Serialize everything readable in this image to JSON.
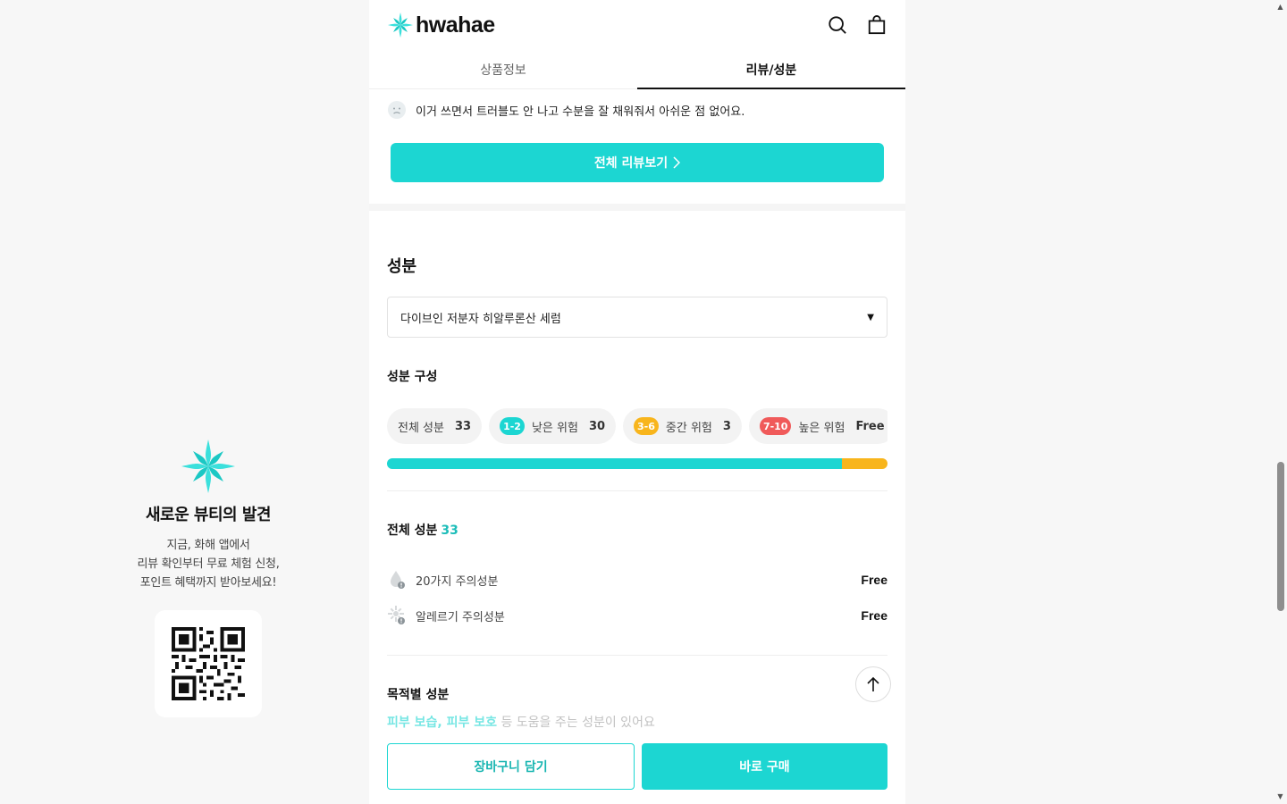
{
  "promo": {
    "title": "새로운 뷰티의 발견",
    "desc": "지금, 화해 앱에서\n리뷰 확인부터 무료 체험 신청,\n포인트 혜택까지 받아보세요!"
  },
  "header": {
    "brand": "hwahae",
    "icons": [
      "search-icon",
      "shopping-bag-icon"
    ]
  },
  "tabs": [
    {
      "label": "상품정보",
      "active": false
    },
    {
      "label": "리뷰/성분",
      "active": true
    }
  ],
  "review": {
    "text": "이거 쓰면서 트러블도 안 나고 수분을 잘 채워줘서 아쉬운 점 없어요.",
    "all_reviews_button": "전체 리뷰보기"
  },
  "ingredients": {
    "section_title": "성분",
    "selected_product": "다이브인 저분자 히알루론산 세럼",
    "composition_title": "성분 구성",
    "chips": [
      {
        "label": "전체 성분",
        "count": "33",
        "badge": "",
        "badge_color": ""
      },
      {
        "label": "낮은 위험",
        "count": "30",
        "badge": "1-2",
        "badge_color": "#1cd6d2"
      },
      {
        "label": "중간 위험",
        "count": "3",
        "badge": "3-6",
        "badge_color": "#f8b51c"
      },
      {
        "label": "높은 위험",
        "count": "Free",
        "badge": "7-10",
        "badge_color": "#f05a5a"
      }
    ],
    "risk_bar": {
      "low": 30,
      "mid": 3,
      "high": 0,
      "low_color": "#1cd6d2",
      "mid_color": "#f8b51c"
    },
    "total_title": "전체 성분",
    "total_count": "33",
    "cautions": [
      {
        "label": "20가지 주의성분",
        "value": "Free",
        "icon": "drop-caution-icon"
      },
      {
        "label": "알레르기 주의성분",
        "value": "Free",
        "icon": "allergy-caution-icon"
      }
    ],
    "purpose_title": "목적별 성분",
    "purpose_highlight_1": "피부 보습",
    "purpose_sep": ", ",
    "purpose_highlight_2": "피부 보호",
    "purpose_rest": " 등 도움을 주는 성분이 있어요"
  },
  "bottom": {
    "cart_label": "장바구니 담기",
    "buy_label": "바로 구매"
  },
  "colors": {
    "accent": "#1cd6d2"
  }
}
